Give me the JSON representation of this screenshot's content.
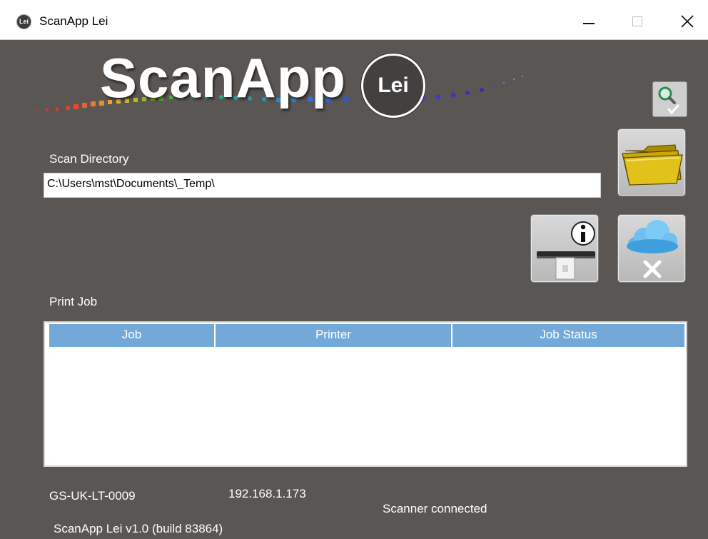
{
  "window": {
    "icon_text": "Lei",
    "title": "ScanApp Lei"
  },
  "logo": {
    "text": "ScanApp",
    "badge": "Lei"
  },
  "scan_directory": {
    "label": "Scan Directory",
    "value": "C:\\Users\\mst\\Documents\\_Temp\\"
  },
  "print_job": {
    "label": "Print Job",
    "columns": [
      "Job",
      "Printer",
      "Job Status"
    ],
    "rows": []
  },
  "footer": {
    "hostname": "GS-UK-LT-0009",
    "ip_address": "192.168.1.173",
    "scanner_status": "Scanner connected",
    "version": "ScanApp Lei v1.0 (build 83864)"
  },
  "icons": {
    "validate": "magnifier-check-icon",
    "folder": "folder-icon",
    "scanner_info": "scanner-info-icon",
    "cloud_remove": "cloud-remove-icon"
  },
  "colors": {
    "background": "#5a5654",
    "table_header": "#73a9d9",
    "button_tile": "#c9c9c9"
  }
}
